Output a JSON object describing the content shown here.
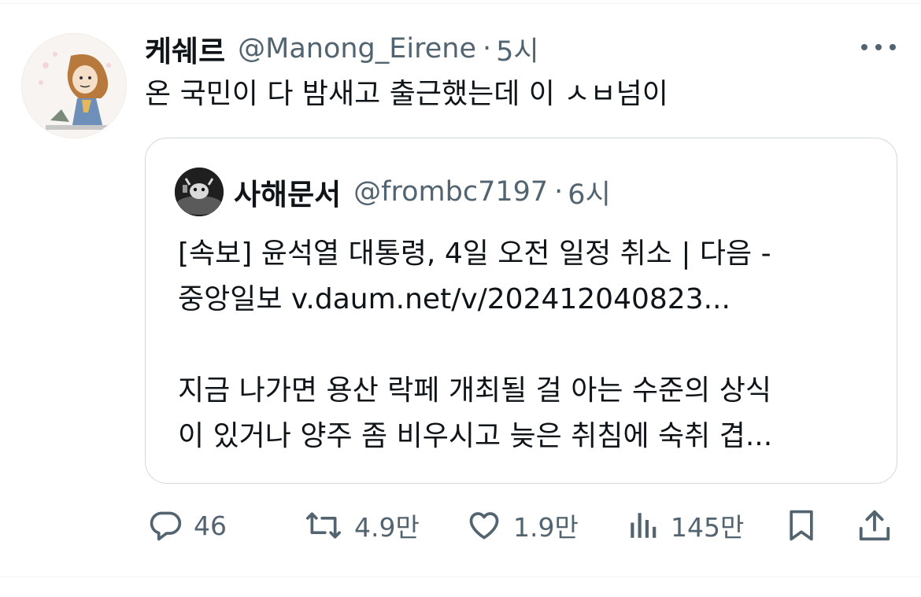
{
  "tweet": {
    "display_name": "케쉐르",
    "handle": "@Manong_Eirene",
    "separator": "·",
    "time": "5시",
    "text": "온 국민이 다 밤새고 출근했는데 이 ㅅㅂ넘이"
  },
  "quote": {
    "display_name": "사해문서",
    "handle": "@frombc7197",
    "separator": "·",
    "time": "6시",
    "lines": [
      "[속보] 윤석열 대통령, 4일 오전 일정 취소 | 다음 -",
      "중앙일보 v.daum.net/v/202412040823...",
      "",
      "지금 나가면 용산 락페 개최될 걸 아는 수준의 상식",
      "이 있거나 양주 좀 비우시고 늦은 취침에 숙취 겹..."
    ]
  },
  "actions": {
    "reply_count": "46",
    "retweet_count": "4.9만",
    "like_count": "1.9만",
    "views_count": "145만"
  },
  "icons": {
    "more": "more-horizontal-icon",
    "reply": "reply-icon",
    "retweet": "retweet-icon",
    "like": "heart-icon",
    "views": "views-chart-icon",
    "bookmark": "bookmark-icon",
    "share": "share-icon"
  },
  "colors": {
    "text_primary": "#0f1419",
    "text_secondary": "#536471",
    "border": "#cfd9de"
  }
}
